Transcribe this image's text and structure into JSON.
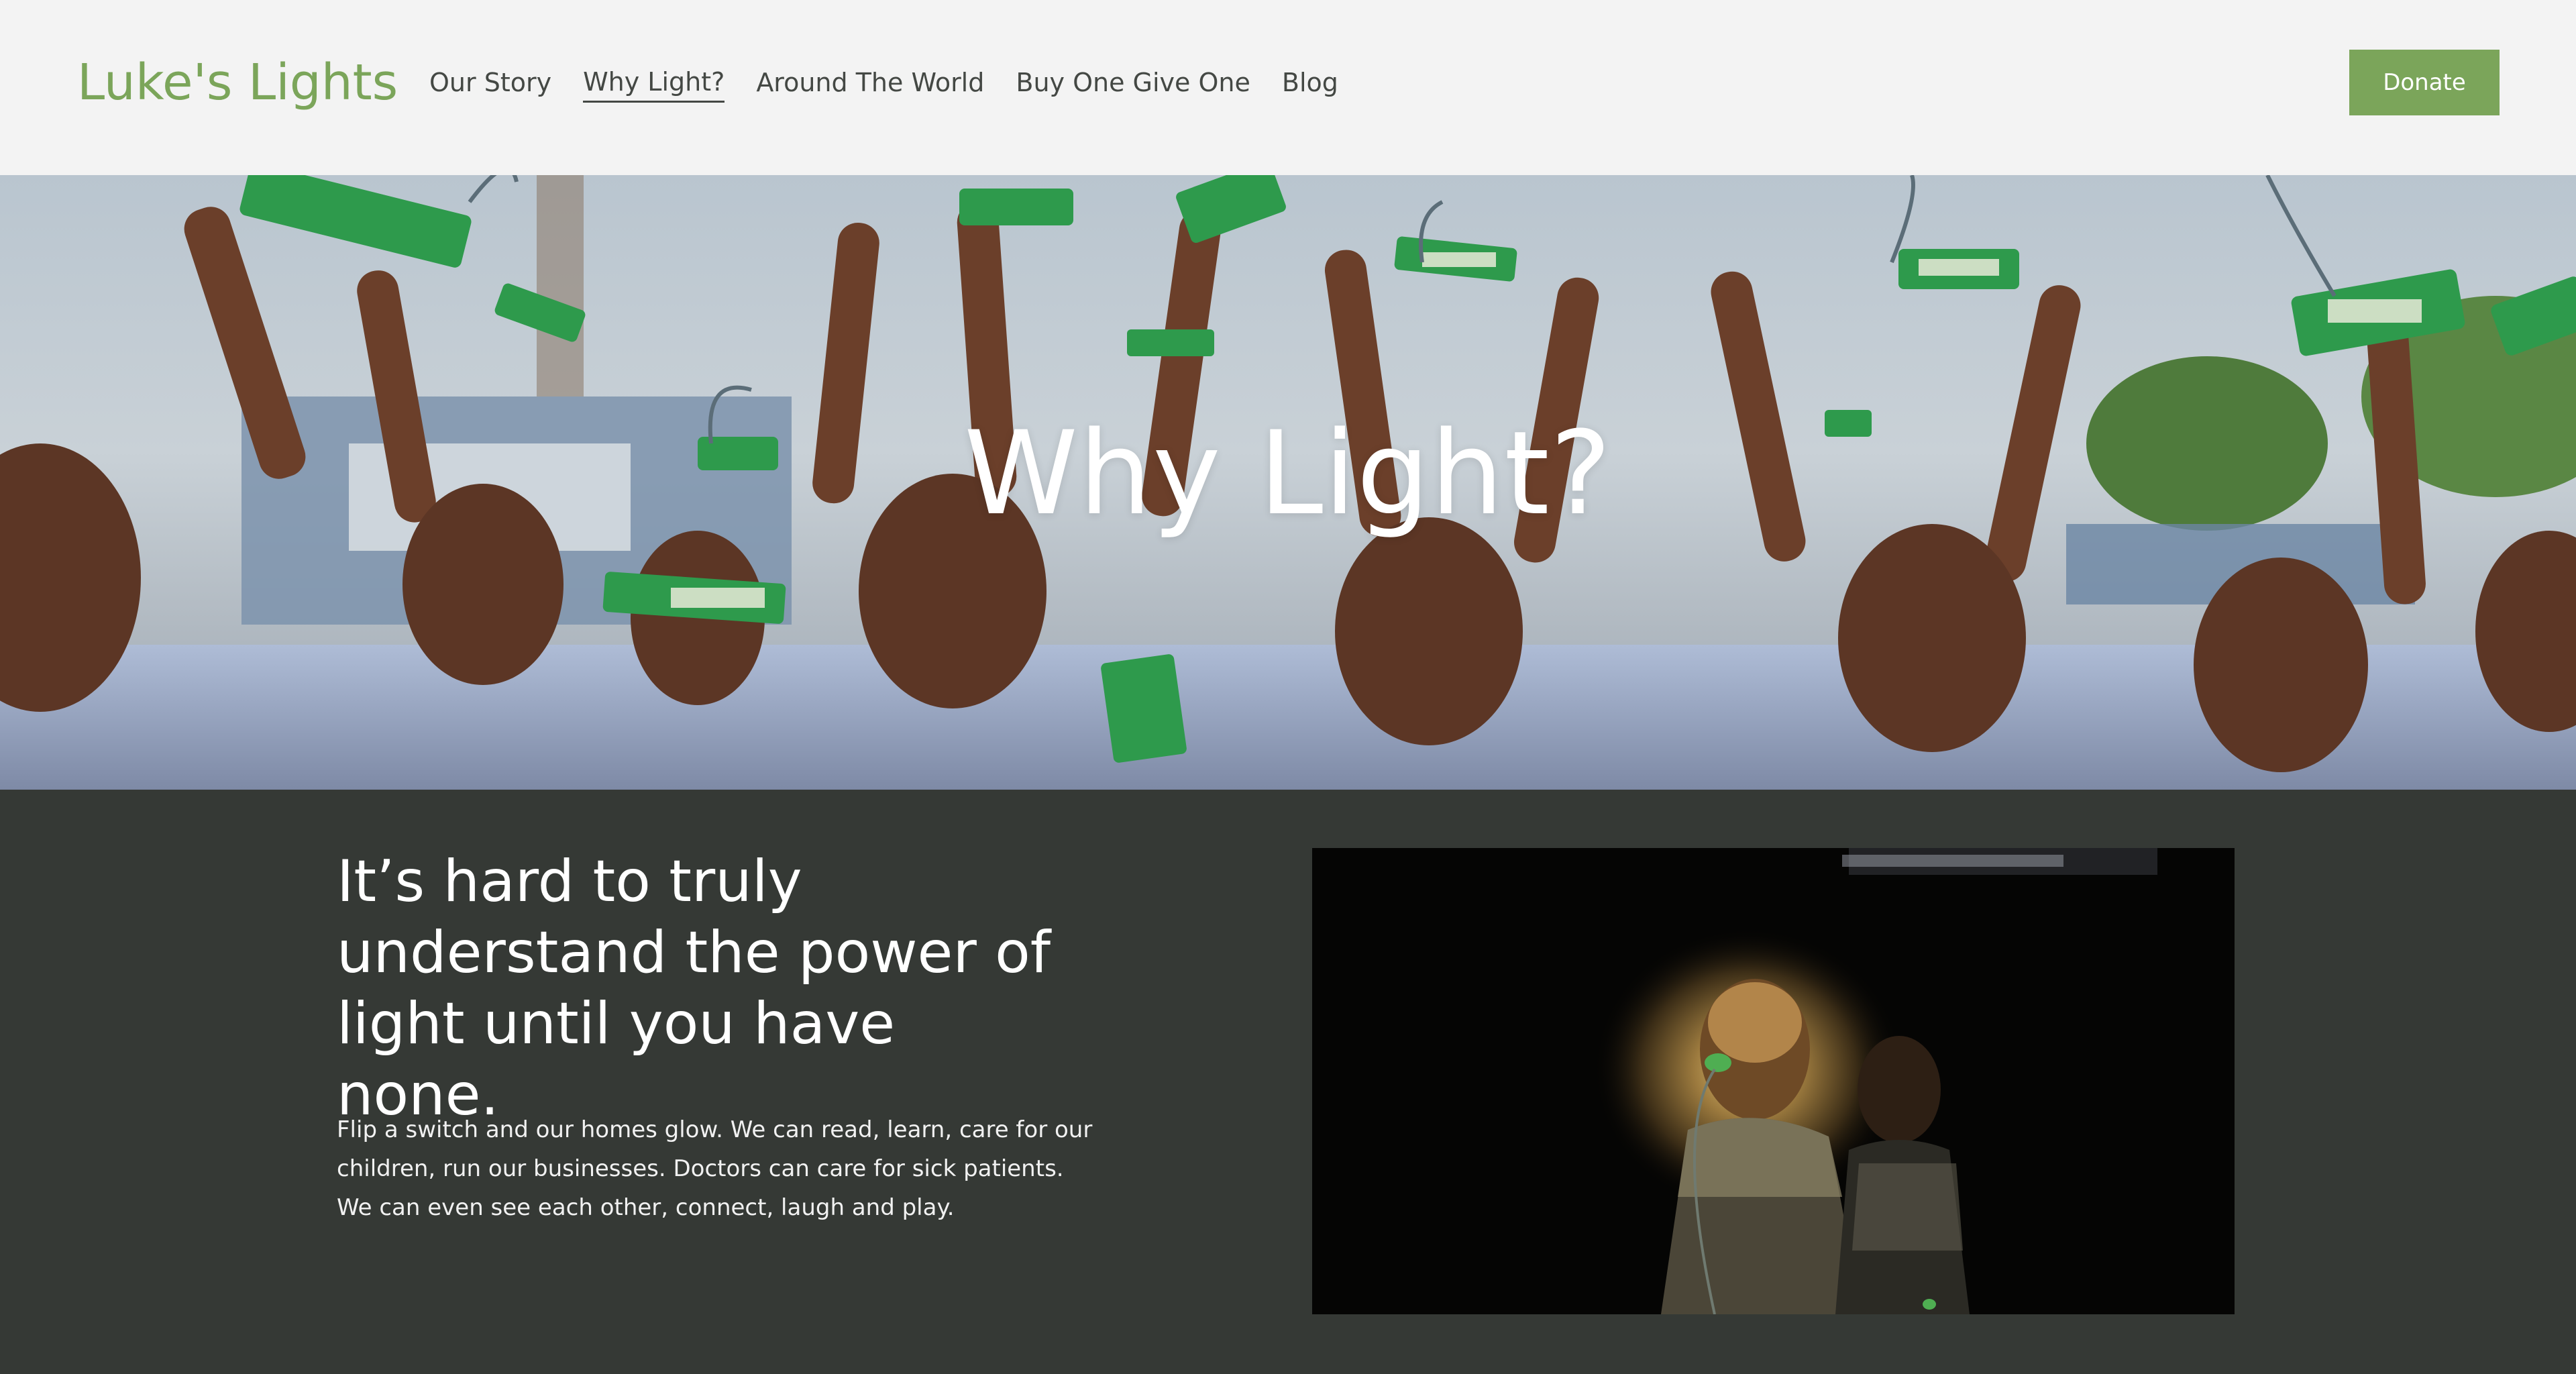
{
  "header": {
    "logo": "Luke's Lights",
    "nav": [
      {
        "label": "Our Story",
        "active": false
      },
      {
        "label": "Why Light?",
        "active": true
      },
      {
        "label": "Around The World",
        "active": false
      },
      {
        "label": "Buy One Give One",
        "active": false
      },
      {
        "label": "Blog",
        "active": false
      }
    ],
    "donate_label": "Donate"
  },
  "hero": {
    "title": "Why Light?"
  },
  "content": {
    "headline": "It’s hard to truly understand the power of light until you have none.",
    "body": "Flip a switch and our homes glow. We can read, learn, care for our children, run our businesses. Doctors can care for sick patients. We can even see each other, connect, laugh and play."
  },
  "colors": {
    "brand_green": "#7ba55a",
    "header_bg": "#f3f3f3",
    "content_bg": "#353935",
    "nav_text": "#444844"
  }
}
